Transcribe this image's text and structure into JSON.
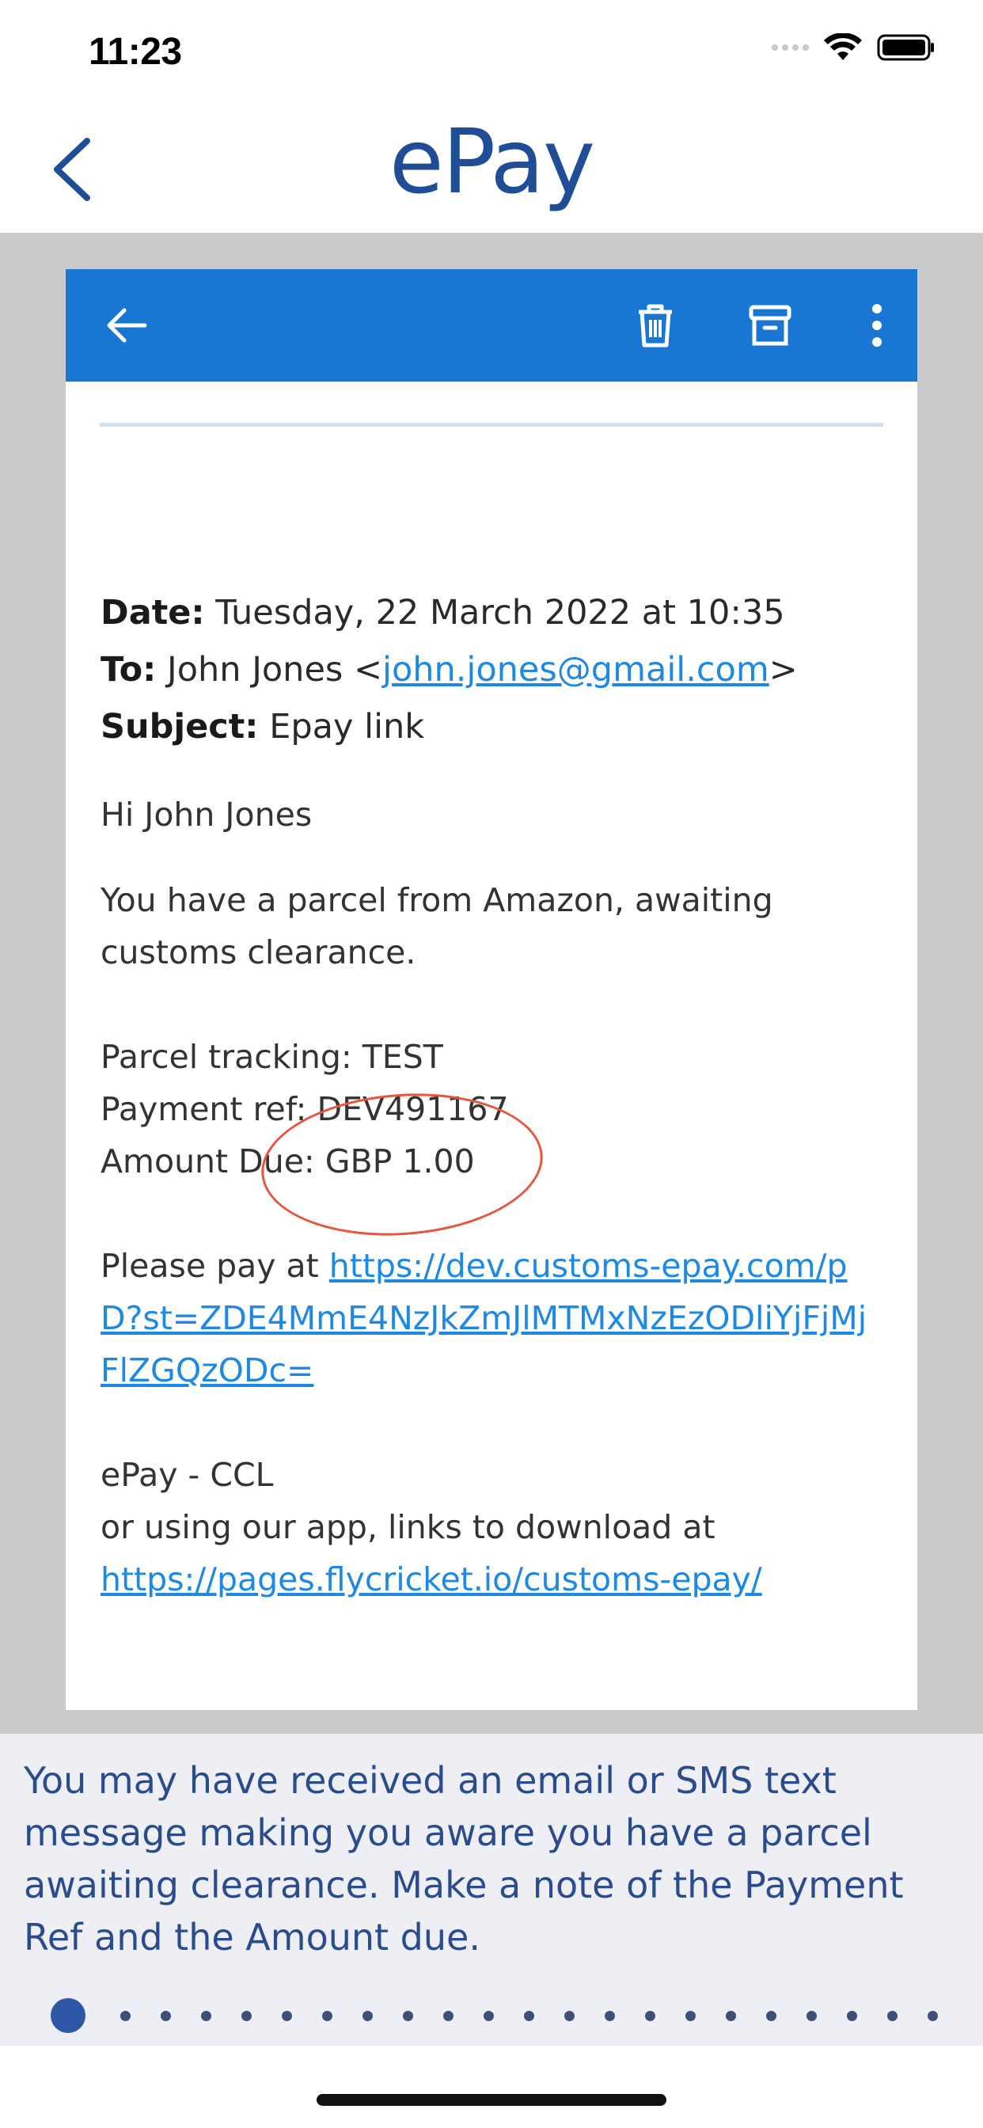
{
  "status_bar": {
    "time": "11:23",
    "icons": [
      "cellular-signal-icon",
      "wifi-icon",
      "battery-icon"
    ]
  },
  "nav": {
    "title": "ePay",
    "back_icon": "chevron-left-icon",
    "title_color": "#1f4e96"
  },
  "email": {
    "toolbar_color": "#1976d2",
    "toolbar_icons": [
      "arrow-left-icon",
      "trash-icon",
      "archive-icon",
      "more-vertical-icon"
    ],
    "date_label": "Date:",
    "date_value": "Tuesday, 22 March 2022 at 10:35",
    "to_label": "To:",
    "to_name": "John Jones <",
    "to_email": "john.jones@gmail.com",
    "to_close": ">",
    "subject_label": "Subject:",
    "subject_value": "Epay link",
    "greeting": "Hi John Jones",
    "intro": "You have a parcel from Amazon, awaiting customs clearance.",
    "tracking": "Parcel tracking: TEST",
    "payment_ref": "Payment ref: DEV491167",
    "amount_due": "Amount Due: GBP 1.00",
    "pay_prefix": "Please pay at ",
    "pay_link": "https://dev.customs-epay.com/pD?st=ZDE4MmE4NzJkZmJlMTMxNzEzODliYjFjMjFlZGQzODc=",
    "signature": "ePay - CCL",
    "app_text": "or using our app, links to download at",
    "app_link": "https://pages.flycricket.io/customs-epay/",
    "link_color": "#1e88e5",
    "annotation_color": "#e8553e"
  },
  "info": {
    "text": "You may have received an email or SMS text message making you aware you have a parcel awaiting clearance.  Make a note of the Payment Ref and the Amount due.",
    "text_color": "#2b4c8c"
  },
  "pager": {
    "total_pages": 22,
    "current_page": 1
  }
}
